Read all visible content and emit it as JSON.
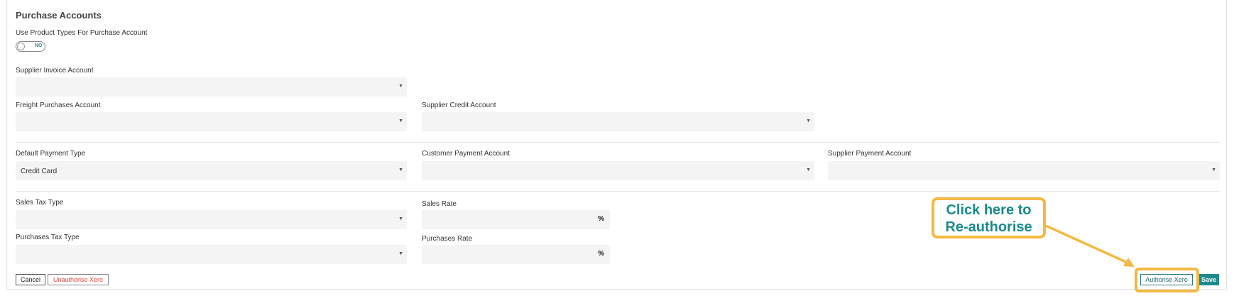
{
  "section": {
    "title": "Purchase Accounts"
  },
  "use_product_types": {
    "label": "Use Product Types For Purchase Account",
    "toggle_text": "NO"
  },
  "supplier_invoice_account": {
    "label": "Supplier Invoice Account",
    "value": ""
  },
  "freight_purchases_account": {
    "label": "Freight Purchases Account",
    "value": ""
  },
  "supplier_credit_account": {
    "label": "Supplier Credit Account",
    "value": ""
  },
  "default_payment_type": {
    "label": "Default Payment Type",
    "value": "Credit Card"
  },
  "customer_payment_account": {
    "label": "Customer Payment Account",
    "value": ""
  },
  "supplier_payment_account": {
    "label": "Supplier Payment Account",
    "value": ""
  },
  "sales_tax_type": {
    "label": "Sales Tax Type",
    "value": ""
  },
  "sales_rate": {
    "label": "Sales Rate",
    "value": "",
    "unit": "%"
  },
  "purchases_tax_type": {
    "label": "Purchases Tax Type",
    "value": ""
  },
  "purchases_rate": {
    "label": "Purchases Rate",
    "value": "",
    "unit": "%"
  },
  "buttons": {
    "cancel": "Cancel",
    "unauthorise_xero": "Unauthorise Xero",
    "authorise_xero": "Authorise Xero",
    "save": "Save"
  },
  "annotation": {
    "line1": "Click here to",
    "line2": "Re-authorise",
    "color": "#f4b942",
    "text_color": "#1b8a8a"
  },
  "colors": {
    "accent": "#1d8b8b",
    "danger": "#e04848",
    "field_bg": "#f4f4f4"
  }
}
